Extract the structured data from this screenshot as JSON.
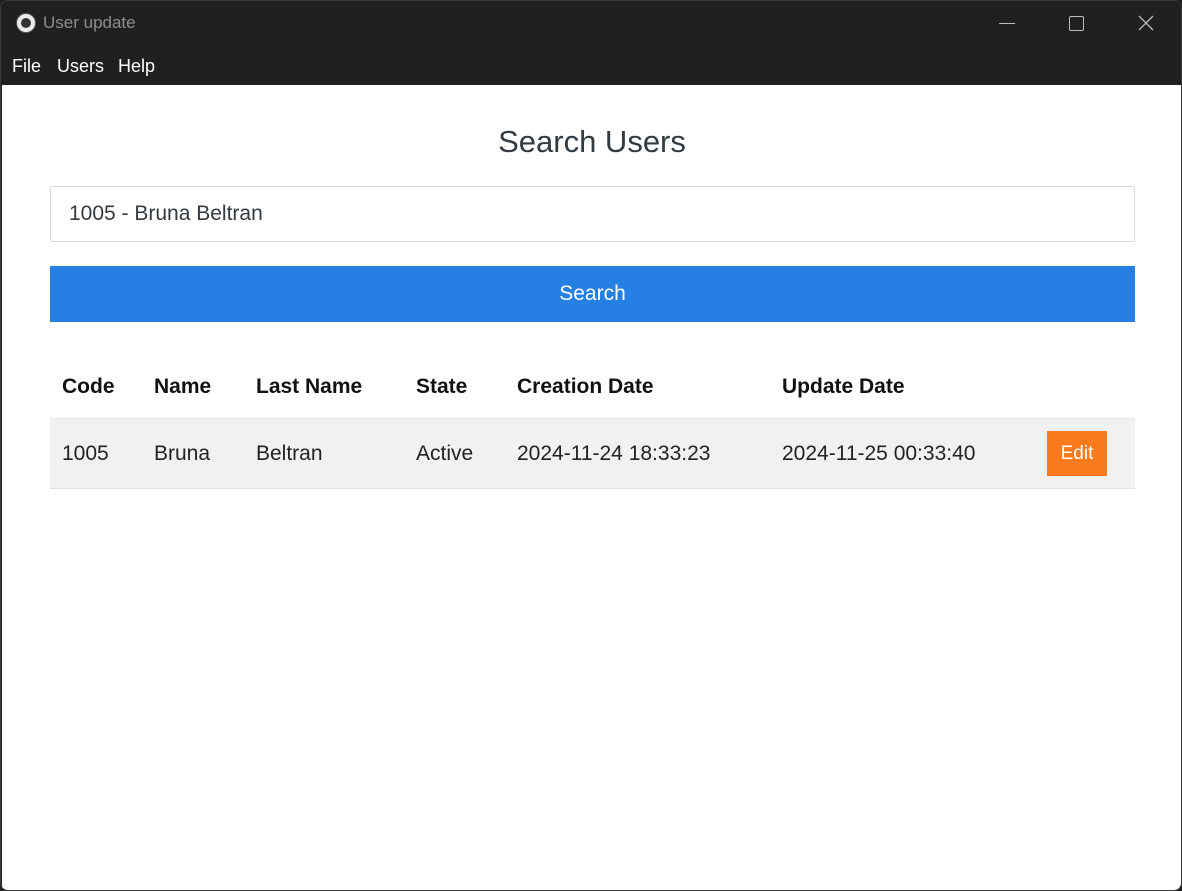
{
  "window": {
    "title": "User update",
    "icon": "app-logo-icon",
    "controls": [
      "minimize-icon",
      "maximize-icon",
      "close-icon"
    ]
  },
  "menu": {
    "items": [
      "File",
      "Users",
      "Help"
    ]
  },
  "page": {
    "title": "Search Users"
  },
  "search": {
    "value": "1005 - Bruna Beltran",
    "button_label": "Search"
  },
  "table": {
    "headers": [
      "Code",
      "Name",
      "Last Name",
      "State",
      "Creation Date",
      "Update Date"
    ],
    "rows": [
      {
        "code": "1005",
        "name": "Bruna",
        "last_name": "Beltran",
        "state": "Active",
        "creation_date": "2024-11-24 18:33:23",
        "update_date": "2024-11-25 00:33:40",
        "action_label": "Edit"
      }
    ]
  },
  "colors": {
    "titlebar": "#202020",
    "primary_button": "#2680e3",
    "edit_button": "#fb7a1c",
    "row_background": "#f1f1f1"
  }
}
